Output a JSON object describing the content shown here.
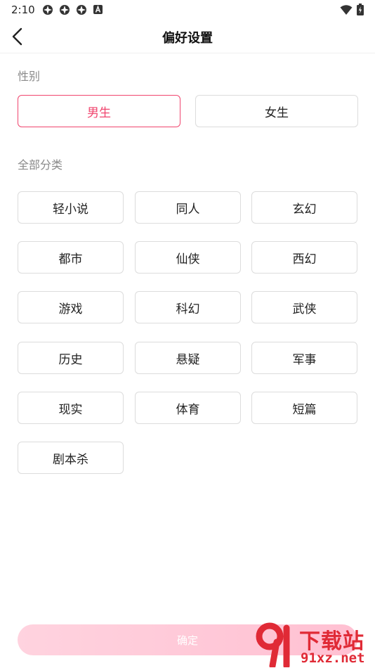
{
  "status_bar": {
    "time": "2:10",
    "icons": [
      "app-notification-icon",
      "app-notification-icon",
      "app-notification-icon",
      "a-badge-icon",
      "wifi-icon",
      "battery-icon"
    ]
  },
  "nav": {
    "title": "偏好设置"
  },
  "gender": {
    "label": "性别",
    "options": [
      "男生",
      "女生"
    ],
    "selected": "男生"
  },
  "categories": {
    "label": "全部分类",
    "items": [
      "轻小说",
      "同人",
      "玄幻",
      "都市",
      "仙侠",
      "西幻",
      "游戏",
      "科幻",
      "武侠",
      "历史",
      "悬疑",
      "军事",
      "现实",
      "体育",
      "短篇",
      "剧本杀"
    ]
  },
  "confirm": {
    "label": "确定"
  },
  "watermark": {
    "top": "下载站",
    "bottom": "91xz.net"
  },
  "colors": {
    "accent": "#f0456e",
    "confirm_gradient_start": "#ffd3df",
    "confirm_gradient_end": "#ffc0d2",
    "watermark": "#e02a36"
  }
}
